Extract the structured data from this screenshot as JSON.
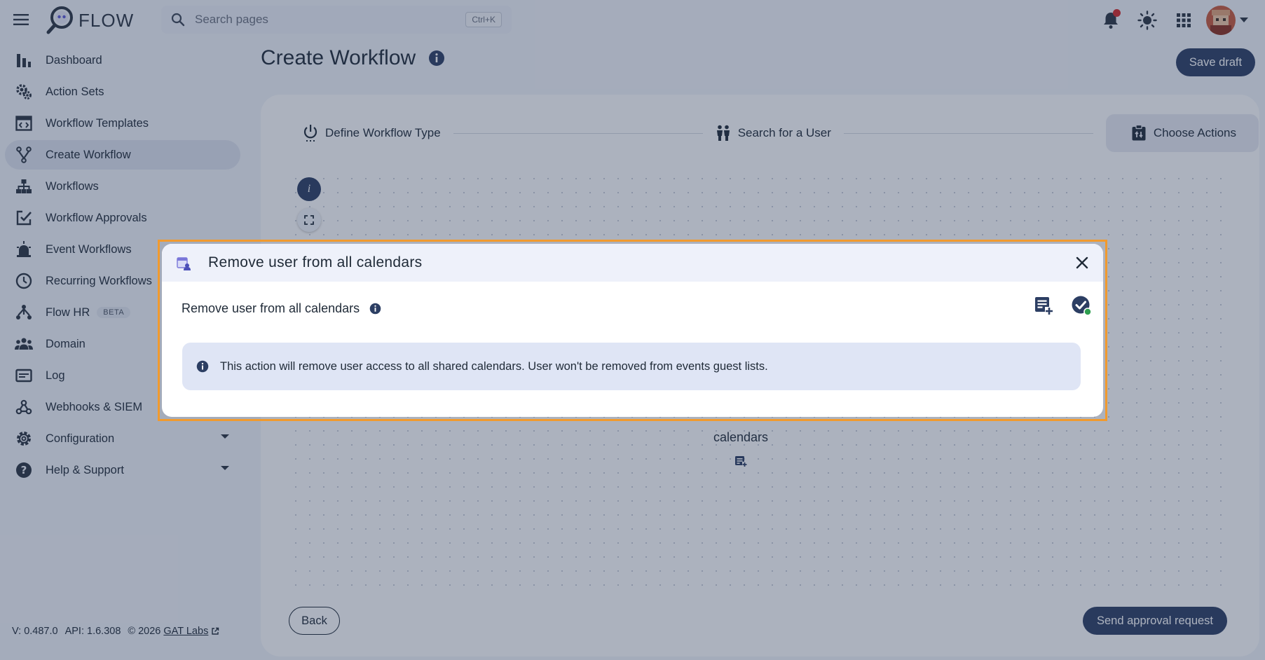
{
  "app": {
    "name": "FLOW"
  },
  "search": {
    "placeholder": "Search pages",
    "shortcut": "Ctrl+K"
  },
  "sidebar": {
    "items": [
      {
        "label": "Dashboard",
        "icon": "bar-chart-icon"
      },
      {
        "label": "Action Sets",
        "icon": "gears-icon"
      },
      {
        "label": "Workflow Templates",
        "icon": "template-icon"
      },
      {
        "label": "Create Workflow",
        "icon": "fork-icon",
        "active": true
      },
      {
        "label": "Workflows",
        "icon": "hierarchy-icon"
      },
      {
        "label": "Workflow Approvals",
        "icon": "approval-icon"
      },
      {
        "label": "Event Workflows",
        "icon": "alarm-icon"
      },
      {
        "label": "Recurring Workflows",
        "icon": "clock-icon"
      },
      {
        "label": "Flow HR",
        "icon": "people-tree-icon",
        "badge": "BETA"
      },
      {
        "label": "Domain",
        "icon": "group-icon"
      },
      {
        "label": "Log",
        "icon": "log-icon"
      },
      {
        "label": "Webhooks & SIEM",
        "icon": "webhook-icon"
      },
      {
        "label": "Configuration",
        "icon": "gear-icon",
        "expandable": true
      },
      {
        "label": "Help & Support",
        "icon": "help-icon",
        "expandable": true
      }
    ],
    "version": "V: 0.487.0",
    "api": "API: 1.6.308",
    "copyright": "© 2026",
    "company_link": "GAT Labs"
  },
  "main": {
    "title": "Create Workflow",
    "save_draft": "Save draft",
    "steps": [
      {
        "label": "Define Workflow Type",
        "icon": "power-icon"
      },
      {
        "label": "Search for a User",
        "icon": "users-icon"
      },
      {
        "label": "Choose Actions",
        "icon": "actions-icon",
        "current": true
      }
    ],
    "node_label": "calendars",
    "back": "Back",
    "send_approval": "Send approval request"
  },
  "dialog": {
    "title": "Remove user from all calendars",
    "action_name": "Remove user from all calendars",
    "info_text": "This action will remove user access to all shared calendars. User won't be removed from events guest lists."
  },
  "colors": {
    "primary": "#2c3e63",
    "highlight_border": "#f19a2e",
    "notification": "#d62828",
    "success": "#2e9e4f",
    "alert_bg": "#dfe5f5"
  }
}
